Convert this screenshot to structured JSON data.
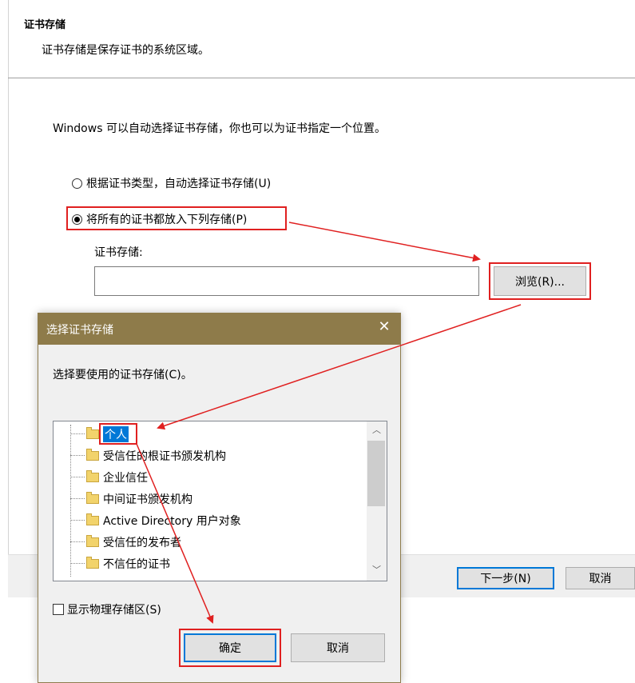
{
  "wizard": {
    "header_title": "证书存储",
    "header_desc": "证书存储是保存证书的系统区域。",
    "intro": "Windows 可以自动选择证书存储，你也可以为证书指定一个位置。",
    "radio_auto_label": "根据证书类型，自动选择证书存储(U)",
    "radio_manual_label": "将所有的证书都放入下列存储(P)",
    "store_label": "证书存储:",
    "store_value": "",
    "browse_label": "浏览(R)...",
    "next_label": "下一步(N)",
    "cancel_label": "取消"
  },
  "dialog": {
    "title": "选择证书存储",
    "close_glyph": "✕",
    "prompt": "选择要使用的证书存储(C)。",
    "stores": [
      "个人",
      "受信任的根证书颁发机构",
      "企业信任",
      "中间证书颁发机构",
      "Active Directory 用户对象",
      "受信任的发布者",
      "不信任的证书"
    ],
    "selected_store": "个人",
    "show_physical_label": "显示物理存储区(S)",
    "ok_label": "确定",
    "cancel_label": "取消"
  },
  "colors": {
    "annotation_red": "#e02020",
    "dialog_titlebar": "#8e7b4a",
    "selection_blue": "#0078d7"
  }
}
